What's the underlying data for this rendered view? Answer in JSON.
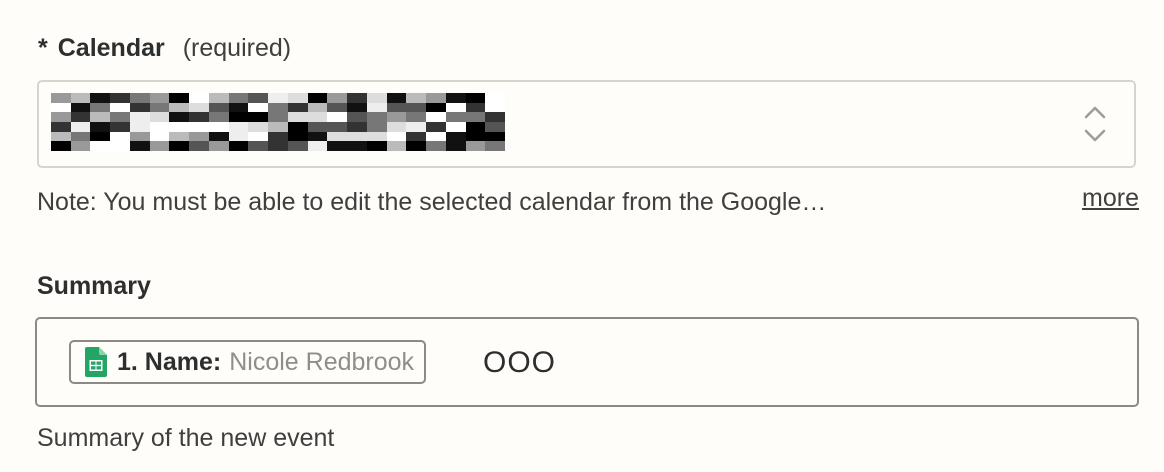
{
  "calendar": {
    "required_star": "*",
    "label": "Calendar",
    "required_text": "(required)",
    "selected_value": "",
    "note": "Note: You must be able to edit the selected calendar from the Google…",
    "more_label": "more"
  },
  "summary": {
    "label": "Summary",
    "token": {
      "icon": "google-sheets-icon",
      "key": "1. Name:",
      "value": "Nicole Redbrook"
    },
    "text_after_token": "OOO",
    "help": "Summary of the new event"
  },
  "colors": {
    "sheets_green": "#23a566",
    "border": "#d6d5cb",
    "background": "#fffdf9"
  }
}
